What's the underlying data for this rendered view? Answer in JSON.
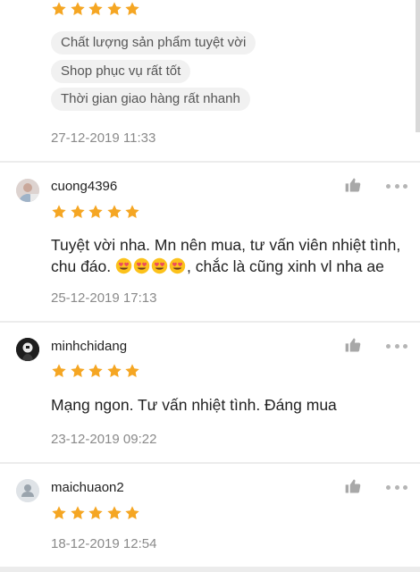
{
  "accent": "#f5a623",
  "review0": {
    "tags": [
      "Chất lượng sản phẩm tuyệt vời",
      "Shop phục vụ rất tốt",
      "Thời gian giao hàng rất nhanh"
    ],
    "date": "27-12-2019 11:33",
    "rating": 5
  },
  "review1": {
    "username": "cuong4396",
    "rating": 5,
    "comment_line1": "Tuyệt vời nha. Mn nên mua, tư vấn viên nhiệt tình,",
    "comment_line2_before": "chu đáo.",
    "comment_line2_emoji": "heart-eyes-emoji x4",
    "comment_line2_after": ", chắc là cũng xinh vl nha ae",
    "date": "25-12-2019 17:13"
  },
  "review2": {
    "username": "minhchidang",
    "rating": 5,
    "comment": "Mạng ngon. Tư vấn nhiệt tình. Đáng mua",
    "date": "23-12-2019 09:22"
  },
  "review3": {
    "username": "maichuaon2",
    "rating": 5,
    "date": "18-12-2019 12:54"
  },
  "icons": {
    "like": "thumbs-up-icon",
    "more": "more-options-icon",
    "star": "star-icon"
  }
}
